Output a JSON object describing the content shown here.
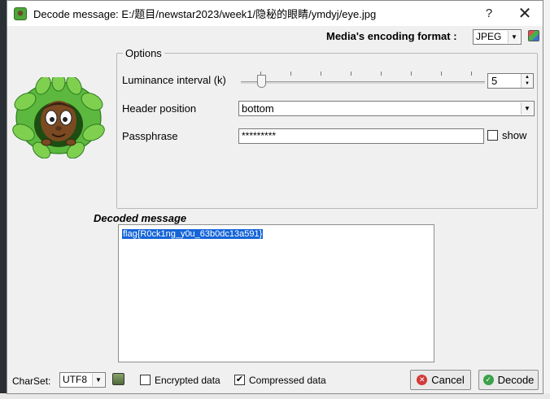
{
  "window": {
    "title": "Decode message: E:/题目/newstar2023/week1/隐秘的眼睛/ymdyj/eye.jpg",
    "help_label": "?",
    "close_label": "✕"
  },
  "encoding": {
    "label": "Media's encoding format :",
    "value": "JPEG"
  },
  "options": {
    "legend": "Options",
    "luminance_label": "Luminance interval (k)",
    "luminance_value": "5",
    "header_label": "Header position",
    "header_value": "bottom",
    "passphrase_label": "Passphrase",
    "passphrase_value": "*********",
    "show_label": "show",
    "show_checked": false
  },
  "decoded": {
    "label": "Decoded message",
    "text": "flag{R0ck1ng_y0u_63b0dc13a591}"
  },
  "footer": {
    "charset_label": "CharSet:",
    "charset_value": "UTF8",
    "encrypted_label": "Encrypted data",
    "encrypted_checked": false,
    "compressed_label": "Compressed data",
    "compressed_checked": true,
    "cancel_label": "Cancel",
    "decode_label": "Decode"
  },
  "colors": {
    "selection": "#1565d8",
    "cancel_icon": "#d23a3a",
    "decode_icon": "#3aa14a"
  }
}
